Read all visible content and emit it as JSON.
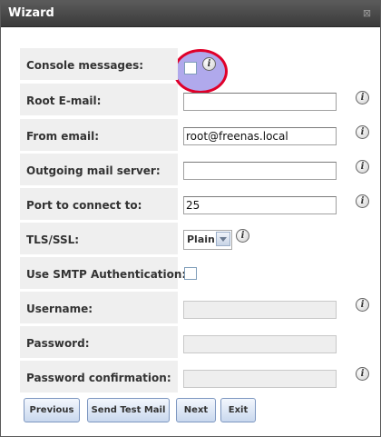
{
  "window": {
    "title": "Wizard",
    "close_glyph": "⊠"
  },
  "form": {
    "console_messages": {
      "label": "Console messages:",
      "checked": false
    },
    "root_email": {
      "label": "Root E-mail:",
      "value": ""
    },
    "from_email": {
      "label": "From email:",
      "value": "root@freenas.local"
    },
    "outgoing_mail_server": {
      "label": "Outgoing mail server:",
      "value": ""
    },
    "port": {
      "label": "Port to connect to:",
      "value": "25"
    },
    "tls_ssl": {
      "label": "TLS/SSL:",
      "selected": "Plain"
    },
    "smtp_auth": {
      "label": "Use SMTP Authentication:",
      "checked": false
    },
    "username": {
      "label": "Username:",
      "value": ""
    },
    "password": {
      "label": "Password:",
      "value": ""
    },
    "password_confirmation": {
      "label": "Password confirmation:",
      "value": ""
    }
  },
  "buttons": {
    "previous": "Previous",
    "send_test_mail": "Send Test Mail",
    "next": "Next",
    "exit": "Exit"
  },
  "icons": {
    "info": "i"
  },
  "colors": {
    "highlight_ring": "#e0002a",
    "highlight_fill": "#968ce6"
  }
}
